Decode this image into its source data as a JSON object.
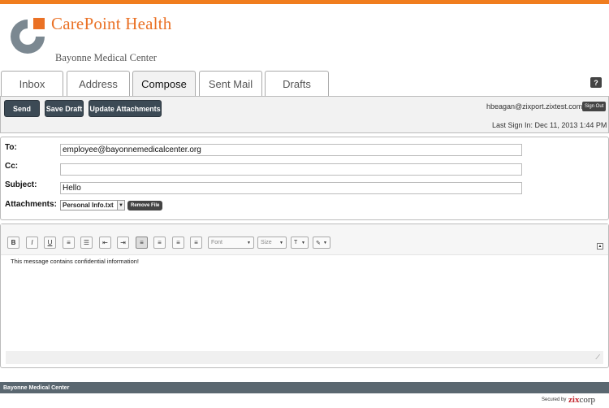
{
  "brand": {
    "name": "CarePoint Health",
    "subtitle": "Bayonne Medical Center",
    "accent_color": "#ea7125"
  },
  "tabs": [
    {
      "label": "Inbox",
      "active": false
    },
    {
      "label": "Address",
      "active": false
    },
    {
      "label": "Compose",
      "active": true
    },
    {
      "label": "Sent Mail",
      "active": false
    },
    {
      "label": "Drafts",
      "active": false
    }
  ],
  "help": {
    "label": "?"
  },
  "toolbar": {
    "send_label": "Send",
    "save_draft_label": "Save Draft",
    "update_attachments_label": "Update Attachments"
  },
  "user": {
    "email": "hbeagan@zixport.zixtest.com",
    "sign_out_label": "Sign Out",
    "last_sign_in": "Last Sign In: Dec 11, 2013 1:44 PM"
  },
  "compose": {
    "to_label": "To:",
    "to_value": "employee@bayonnemedicalcenter.org",
    "cc_label": "Cc:",
    "cc_value": "",
    "subject_label": "Subject:",
    "subject_value": "Hello",
    "attachments_label": "Attachments:",
    "attachment_selected": "Personal Info.txt",
    "remove_file_label": "Remove File"
  },
  "editor": {
    "buttons": [
      {
        "name": "bold-icon",
        "glyph": "B"
      },
      {
        "name": "italic-icon",
        "glyph": "I"
      },
      {
        "name": "underline-icon",
        "glyph": "U"
      },
      {
        "name": "ordered-list-icon",
        "glyph": "≡"
      },
      {
        "name": "unordered-list-icon",
        "glyph": "☰"
      },
      {
        "name": "outdent-icon",
        "glyph": "⇤"
      },
      {
        "name": "indent-icon",
        "glyph": "⇥"
      },
      {
        "name": "align-left-icon",
        "glyph": "≡"
      },
      {
        "name": "align-center-icon",
        "glyph": "≡"
      },
      {
        "name": "align-right-icon",
        "glyph": "≡"
      },
      {
        "name": "justify-icon",
        "glyph": "≡"
      }
    ],
    "font_placeholder": "Font",
    "size_placeholder": "Size",
    "body_text": "This message contains confidential information!"
  },
  "footer": {
    "org_label": "Bayonne Medical Center",
    "secured_by_label": "Secured by",
    "zix_brand": "zix",
    "zix_brand_suffix": "corp"
  }
}
